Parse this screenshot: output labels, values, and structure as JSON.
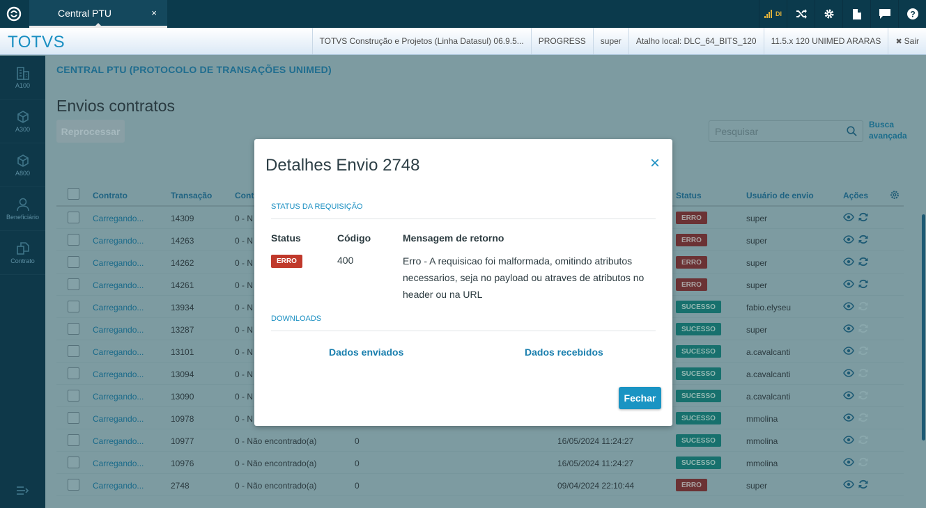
{
  "topbar": {
    "tab_title": "Central PTU",
    "tab_close": "×",
    "signal_label": "DI"
  },
  "infobar": {
    "brand": "TOTVS",
    "product": "TOTVS Construção e Projetos (Linha Datasul) 06.9.5...",
    "database": "PROGRESS",
    "user": "super",
    "shortcut": "Atalho local: DLC_64_BITS_120",
    "version": "11.5.x 120 UNIMED ARARAS",
    "exit_label": "Sair",
    "exit_icon": "✖"
  },
  "sidebar": {
    "items": [
      {
        "label": "A100",
        "icon": "building-icon"
      },
      {
        "label": "A300",
        "icon": "box-icon"
      },
      {
        "label": "A800",
        "icon": "box-icon"
      },
      {
        "label": "Beneficiário",
        "icon": "user-icon"
      },
      {
        "label": "Contrato",
        "icon": "copy-icon"
      }
    ]
  },
  "page": {
    "breadcrumb": "CENTRAL PTU (PROTOCOLO DE TRANSAÇÕES UNIMED)",
    "title": "Envios contratos",
    "reprocess_label": "Reprocessar",
    "search_placeholder": "Pesquisar",
    "advanced_search": "Busca avançada"
  },
  "table": {
    "headers": {
      "contract": "Contrato",
      "transaction": "Transação",
      "cont": "Cont",
      "status": "Status",
      "user": "Usuário de envio",
      "actions": "Ações"
    },
    "rows": [
      {
        "contract": "Carregando...",
        "transaction": "14309",
        "code": "0 - N",
        "qty": "",
        "date": "",
        "status": "ERRO",
        "user": "super",
        "resend": true
      },
      {
        "contract": "Carregando...",
        "transaction": "14263",
        "code": "0 - N",
        "qty": "",
        "date": "",
        "status": "ERRO",
        "user": "super",
        "resend": true
      },
      {
        "contract": "Carregando...",
        "transaction": "14262",
        "code": "0 - N",
        "qty": "",
        "date": "",
        "status": "ERRO",
        "user": "super",
        "resend": true
      },
      {
        "contract": "Carregando...",
        "transaction": "14261",
        "code": "0 - N",
        "qty": "",
        "date": "",
        "status": "ERRO",
        "user": "super",
        "resend": true
      },
      {
        "contract": "Carregando...",
        "transaction": "13934",
        "code": "0 - N",
        "qty": "",
        "date": "",
        "status": "SUCESSO",
        "user": "fabio.elyseu",
        "resend": false
      },
      {
        "contract": "Carregando...",
        "transaction": "13287",
        "code": "0 - N",
        "qty": "",
        "date": "",
        "status": "SUCESSO",
        "user": "super",
        "resend": false
      },
      {
        "contract": "Carregando...",
        "transaction": "13101",
        "code": "0 - N",
        "qty": "",
        "date": "",
        "status": "SUCESSO",
        "user": "a.cavalcanti",
        "resend": false
      },
      {
        "contract": "Carregando...",
        "transaction": "13094",
        "code": "0 - N",
        "qty": "",
        "date": "",
        "status": "SUCESSO",
        "user": "a.cavalcanti",
        "resend": false
      },
      {
        "contract": "Carregando...",
        "transaction": "13090",
        "code": "0 - N",
        "qty": "",
        "date": "",
        "status": "SUCESSO",
        "user": "a.cavalcanti",
        "resend": false
      },
      {
        "contract": "Carregando...",
        "transaction": "10978",
        "code": "0 - N",
        "qty": "",
        "date": "",
        "status": "SUCESSO",
        "user": "mmolina",
        "resend": false
      },
      {
        "contract": "Carregando...",
        "transaction": "10977",
        "code": "0 - Não encontrado(a)",
        "qty": "0",
        "date": "16/05/2024 11:24:27",
        "status": "SUCESSO",
        "user": "mmolina",
        "resend": false
      },
      {
        "contract": "Carregando...",
        "transaction": "10976",
        "code": "0 - Não encontrado(a)",
        "qty": "0",
        "date": "16/05/2024 11:24:27",
        "status": "SUCESSO",
        "user": "mmolina",
        "resend": false
      },
      {
        "contract": "Carregando...",
        "transaction": "2748",
        "code": "0 - Não encontrado(a)",
        "qty": "0",
        "date": "09/04/2024 22:10:44",
        "status": "ERRO",
        "user": "super",
        "resend": true
      }
    ]
  },
  "modal": {
    "title": "Detalhes Envio 2748",
    "close": "×",
    "section_status": "STATUS DA REQUISIÇÃO",
    "col_status": "Status",
    "col_code": "Código",
    "col_message": "Mensagem de retorno",
    "status_value": "ERRO",
    "code_value": "400",
    "message_value": "Erro - A requisicao foi malformada, omitindo atributos necessarios, seja no payload ou atraves de atributos no header ou na URL",
    "section_downloads": "DOWNLOADS",
    "sent_data": "Dados enviados",
    "received_data": "Dados recebidos",
    "close_button": "Fechar"
  },
  "colors": {
    "primary": "#1a94c3",
    "error": "#c0392b",
    "topbar": "#0b3a4c"
  }
}
